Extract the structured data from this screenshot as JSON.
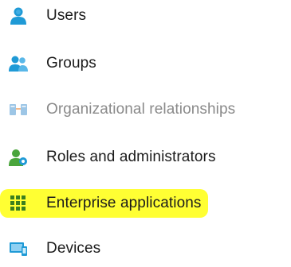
{
  "sidebar": {
    "items": [
      {
        "label": "Users",
        "icon": "user-icon",
        "state": "normal"
      },
      {
        "label": "Groups",
        "icon": "groups-icon",
        "state": "normal"
      },
      {
        "label": "Organizational relationships",
        "icon": "organizational-relationships-icon",
        "state": "disabled"
      },
      {
        "label": "Roles and administrators",
        "icon": "roles-icon",
        "state": "normal"
      },
      {
        "label": "Enterprise applications",
        "icon": "enterprise-apps-icon",
        "state": "highlighted"
      },
      {
        "label": "Devices",
        "icon": "devices-icon",
        "state": "normal"
      }
    ]
  },
  "colors": {
    "highlight": "#ffff33",
    "icon_blue": "#1f9ad6",
    "icon_green": "#4aa53c",
    "enterprise_green": "#3b7f1e",
    "disabled_text": "#8a8a8a"
  }
}
